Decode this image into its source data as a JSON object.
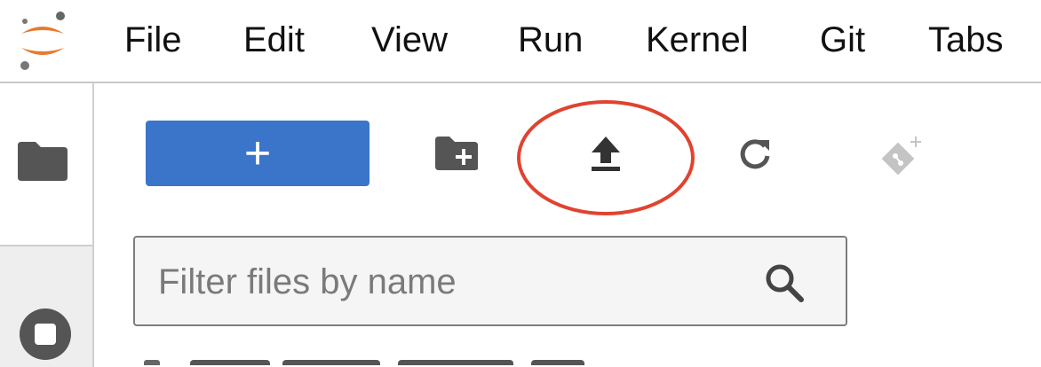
{
  "menubar": {
    "items": [
      {
        "label": "File"
      },
      {
        "label": "Edit"
      },
      {
        "label": "View"
      },
      {
        "label": "Run"
      },
      {
        "label": "Kernel"
      },
      {
        "label": "Git"
      },
      {
        "label": "Tabs"
      }
    ]
  },
  "toolbar": {
    "new_label": "+"
  },
  "filter": {
    "placeholder": "Filter files by name",
    "value": ""
  },
  "icons": {
    "logo": "jupyter-logo-icon",
    "sidebar_folder": "folder-icon",
    "sidebar_stop": "stop-circle-icon",
    "new_folder": "new-folder-icon",
    "upload": "upload-icon",
    "refresh": "refresh-icon",
    "git_clone": "git-clone-icon",
    "search": "search-icon"
  },
  "colors": {
    "accent": "#3a75c9",
    "highlight": "#e0432f",
    "logo_orange": "#e87a2f",
    "icon_gray": "#555555",
    "disabled_gray": "#c4c4c4"
  }
}
